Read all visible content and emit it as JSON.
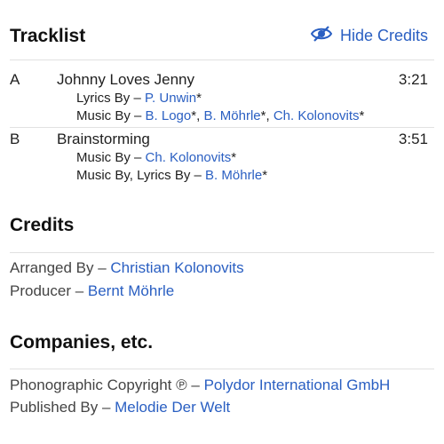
{
  "tracklist": {
    "heading": "Tracklist",
    "hide_credits_label": "Hide Credits",
    "tracks": [
      {
        "position": "A",
        "title": "Johnny Loves Jenny",
        "duration": "3:21",
        "credits": [
          {
            "role": "Lyrics By",
            "sep": " – ",
            "artists": [
              {
                "name": "P. Unwin",
                "suffix": "*"
              }
            ]
          },
          {
            "role": "Music By",
            "sep": " – ",
            "artists": [
              {
                "name": "B. Logo",
                "suffix": "*, "
              },
              {
                "name": "B. Möhrle",
                "suffix": "*, "
              },
              {
                "name": "Ch. Kolonovits",
                "suffix": "*"
              }
            ]
          }
        ]
      },
      {
        "position": "B",
        "title": "Brainstorming",
        "duration": "3:51",
        "credits": [
          {
            "role": "Music By",
            "sep": " – ",
            "artists": [
              {
                "name": "Ch. Kolonovits",
                "suffix": "*"
              }
            ]
          },
          {
            "role": "Music By, Lyrics By",
            "sep": " – ",
            "artists": [
              {
                "name": "B. Möhrle",
                "suffix": "*"
              }
            ]
          }
        ]
      }
    ]
  },
  "credits": {
    "heading": "Credits",
    "items": [
      {
        "role": "Arranged By",
        "sep": " – ",
        "name": "Christian Kolonovits"
      },
      {
        "role": "Producer",
        "sep": " – ",
        "name": "Bernt Möhrle"
      }
    ]
  },
  "companies": {
    "heading": "Companies, etc.",
    "items": [
      {
        "role": "Phonographic Copyright ℗",
        "sep": " – ",
        "name": "Polydor International GmbH"
      },
      {
        "role": "Published By",
        "sep": " – ",
        "name": "Melodie Der Welt"
      }
    ]
  },
  "colors": {
    "link": "#2a5fc2",
    "divider": "#e1e1e1"
  },
  "icons": {
    "hide_credits": "eye-slash-icon"
  }
}
